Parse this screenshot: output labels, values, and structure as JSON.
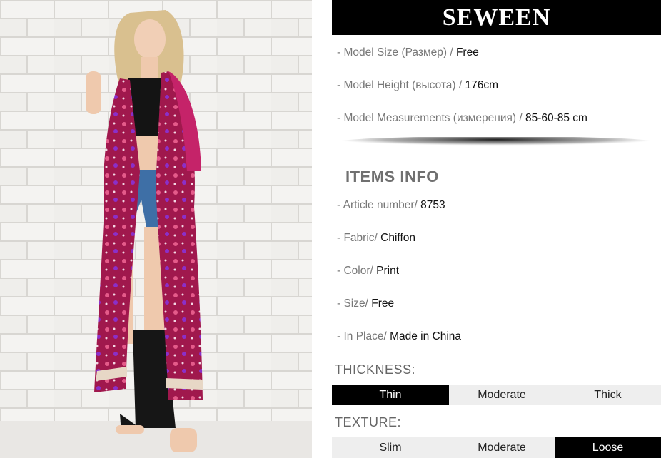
{
  "brand": "SEWEEN",
  "model": [
    {
      "label": "- Model Size (Размер) / ",
      "value": "Free"
    },
    {
      "label": "- Model Height (высота) / ",
      "value": "176cm"
    },
    {
      "label": "- Model Measurements (измерения) / ",
      "value": "85-60-85 cm"
    }
  ],
  "items_title": "ITEMS INFO",
  "items": [
    {
      "label": "- Article number/ ",
      "value": "8753"
    },
    {
      "label": "- Fabric/ ",
      "value": "Chiffon"
    },
    {
      "label": "- Color/ ",
      "value": "Print"
    },
    {
      "label": "- Size/ ",
      "value": "Free"
    },
    {
      "label": "- In Place/ ",
      "value": "Made in China"
    }
  ],
  "thickness": {
    "label": "THICKNESS:",
    "options": [
      "Thin",
      "Moderate",
      "Thick"
    ],
    "selected": "Thin"
  },
  "texture": {
    "label": "TEXTURE:",
    "options": [
      "Slim",
      "Moderate",
      "Loose"
    ],
    "selected": "Loose"
  }
}
